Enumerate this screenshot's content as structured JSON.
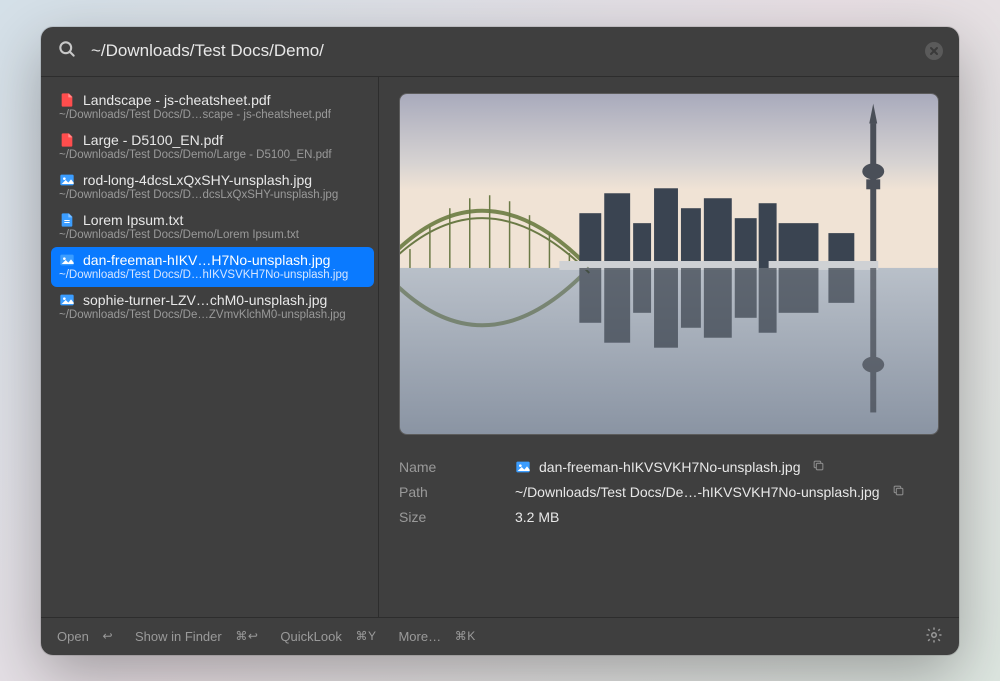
{
  "search": {
    "value": "~/Downloads/Test Docs/Demo/"
  },
  "results": [
    {
      "icon": "pdf",
      "title": "Landscape - js-cheatsheet.pdf",
      "path": "~/Downloads/Test Docs/D…scape - js-cheatsheet.pdf",
      "selected": false
    },
    {
      "icon": "pdf",
      "title": "Large - D5100_EN.pdf",
      "path": "~/Downloads/Test Docs/Demo/Large - D5100_EN.pdf",
      "selected": false
    },
    {
      "icon": "img",
      "title": "rod-long-4dcsLxQxSHY-unsplash.jpg",
      "path": "~/Downloads/Test Docs/D…dcsLxQxSHY-unsplash.jpg",
      "selected": false
    },
    {
      "icon": "txt",
      "title": "Lorem Ipsum.txt",
      "path": "~/Downloads/Test Docs/Demo/Lorem Ipsum.txt",
      "selected": false
    },
    {
      "icon": "img",
      "title": "dan-freeman-hIKV…H7No-unsplash.jpg",
      "path": "~/Downloads/Test Docs/D…hIKVSVKH7No-unsplash.jpg",
      "selected": true
    },
    {
      "icon": "img",
      "title": "sophie-turner-LZV…chM0-unsplash.jpg",
      "path": "~/Downloads/Test Docs/De…ZVmvKlchM0-unsplash.jpg",
      "selected": false
    }
  ],
  "preview": {
    "name_label": "Name",
    "path_label": "Path",
    "size_label": "Size",
    "name": "dan-freeman-hIKVSVKH7No-unsplash.jpg",
    "path": "~/Downloads/Test Docs/De…-hIKVSVKH7No-unsplash.jpg",
    "size": "3.2 MB"
  },
  "footer": {
    "open": "Open",
    "open_kbd": "↩",
    "finder": "Show in Finder",
    "finder_kbd": "⌘↩",
    "quicklook": "QuickLook",
    "quicklook_kbd": "⌘Y",
    "more": "More…",
    "more_kbd": "⌘K"
  }
}
